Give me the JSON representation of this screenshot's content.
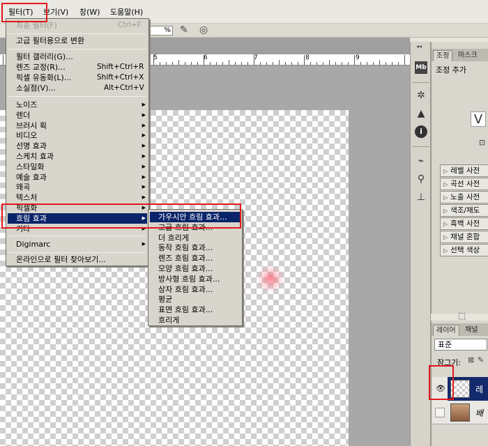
{
  "menubar": {
    "items": [
      "필터(T)",
      "보기(V)",
      "창(W)",
      "도움말(H)"
    ]
  },
  "options_bar": {
    "zoom_suffix": "%"
  },
  "ruler": {
    "labels": [
      "5",
      "6",
      "7",
      "8",
      "9"
    ]
  },
  "filter_menu": {
    "last_filter": {
      "label": "최종 필터(F)",
      "shortcut": "Ctrl+F"
    },
    "convert_smart": "고급 필터용으로 변환",
    "group1": [
      {
        "label": "필터 갤러리(G)...",
        "shortcut": ""
      },
      {
        "label": "렌즈 교정(R)...",
        "shortcut": "Shift+Ctrl+R"
      },
      {
        "label": "픽셀 유동화(L)...",
        "shortcut": "Shift+Ctrl+X"
      },
      {
        "label": "소실점(V)...",
        "shortcut": "Alt+Ctrl+V"
      }
    ],
    "submenus": [
      "노이즈",
      "렌더",
      "브러시 획",
      "비디오",
      "선명 효과",
      "스케치 효과",
      "스타일화",
      "예술 효과",
      "왜곡",
      "텍스처",
      "픽셀화",
      "흐림 효과",
      "기타"
    ],
    "digimarc": "Digimarc",
    "browse_online": "온라인으로 필터 찾아보기..."
  },
  "blur_submenu": {
    "items": [
      "가우시안 흐림 효과...",
      "고급 흐림 효과...",
      "더 흐리게",
      "동작 흐림 효과...",
      "렌즈 흐림 효과...",
      "모양 흐림 효과...",
      "방사형 흐림 효과...",
      "상자 흐림 효과...",
      "평균",
      "표면 흐림 효과...",
      "흐리게"
    ]
  },
  "adjustments_panel": {
    "tabs": [
      "조정",
      "마스크"
    ],
    "title": "조정 추가",
    "presets": [
      "레벨 사전",
      "곡선 사전",
      "노출 사전",
      "색조/채도",
      "흑백 사전",
      "채널 혼합",
      "선택 색상"
    ]
  },
  "layers_panel": {
    "tabs": [
      "레이어",
      "채널"
    ],
    "blend_mode": "표준",
    "lock_label": "잠그기:",
    "layer1_name": "레",
    "layer2_name": "배"
  },
  "icons": {
    "tools": [
      "mini-bridge-icon",
      "compass-icon",
      "histogram-icon",
      "info-icon",
      "brush-icon",
      "clone-icon",
      "stamp-icon"
    ]
  },
  "colors": {
    "highlight": "#0a246a",
    "annotation_red": "#e0181b"
  }
}
